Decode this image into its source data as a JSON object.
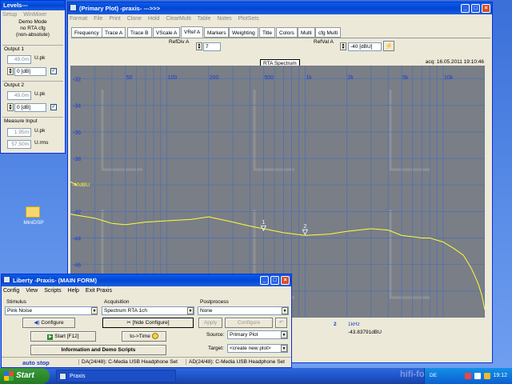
{
  "levels_window": {
    "title": "Levels---",
    "menu": [
      "Setup",
      "WinMixer"
    ],
    "mode_line1": "Demo Mode",
    "mode_line2": "no RTA cfg",
    "mode_line3": "(non-absolute)",
    "output1": {
      "label": "Output 1",
      "value": "49.0m",
      "unit": "U.pk",
      "db": "0 [dB]"
    },
    "output2": {
      "label": "Output 2",
      "value": "49.0m",
      "unit": "U.pk",
      "db": "0 [dB]"
    },
    "measure_input": {
      "label": "Measure Input",
      "value1": "1.95m",
      "unit1": "U.pk",
      "value2": "57.50m",
      "unit2": "U.rms"
    }
  },
  "desktop_icon": {
    "label": "MiniDSP"
  },
  "plot_window": {
    "title": "(Primary Plot) -praxis-   --->>>",
    "menu": [
      "Format",
      "File",
      "Print",
      "Clone",
      "Hold",
      "ClearMulti",
      "Table",
      "Notes",
      "PlotSets"
    ],
    "tabs": [
      "Frequency",
      "Trace A",
      "Trace B",
      "VScale A",
      "VRef A",
      "Markers",
      "Weighting",
      "Title",
      "Colors",
      "Multi",
      "cfg Multi"
    ],
    "active_tab": "VRef A",
    "refdiv_label": "RefDiv A",
    "refdiv_value": "7",
    "refval_label": "RefVal A",
    "refval_value": "-40 [dBU]",
    "plot_title": "RTA Spectrum",
    "acq": "acq: 16.05.2011 19:10:46",
    "ref_marker": "-40dBU",
    "marker_labels": [
      "1",
      "2"
    ],
    "readout_marker": "2",
    "readout_freq": "1kHz",
    "readout_value": "-43.83791dBU"
  },
  "chart_data": {
    "type": "line",
    "title": "RTA Spectrum",
    "x_scale": "log",
    "xlim": [
      20,
      20000
    ],
    "ylim": [
      -50,
      -31
    ],
    "x_ticks": [
      {
        "v": 50,
        "l": "50"
      },
      {
        "v": 100,
        "l": "100"
      },
      {
        "v": 200,
        "l": "200"
      },
      {
        "v": 500,
        "l": "500"
      },
      {
        "v": 1000,
        "l": "1k"
      },
      {
        "v": 2000,
        "l": "2k"
      },
      {
        "v": 5000,
        "l": "5k"
      },
      {
        "v": 10000,
        "l": "10k"
      }
    ],
    "y_ticks": [
      {
        "v": -32,
        "l": "-32"
      },
      {
        "v": -34,
        "l": "-34"
      },
      {
        "v": -36,
        "l": "-36"
      },
      {
        "v": -38,
        "l": "-38"
      },
      {
        "v": -40,
        "l": ""
      },
      {
        "v": -42,
        "l": "-42"
      },
      {
        "v": -44,
        "l": "-44"
      },
      {
        "v": -46,
        "l": "-46"
      },
      {
        "v": -48,
        "l": "-48"
      }
    ],
    "series": [
      {
        "color": "#ffff33",
        "x": [
          20,
          30,
          40,
          50,
          70,
          100,
          150,
          200,
          300,
          400,
          500,
          700,
          1000,
          1500,
          2000,
          3000,
          4000,
          5000,
          6000,
          7000,
          8000,
          10000,
          12000,
          14000,
          15000,
          16000,
          17000,
          18000,
          19000,
          20000
        ],
        "y": [
          -42.2,
          -42.5,
          -42.9,
          -43.0,
          -42.8,
          -42.7,
          -42.6,
          -42.4,
          -42.8,
          -43.1,
          -43.3,
          -43.6,
          -43.8,
          -43.7,
          -43.5,
          -43.3,
          -43.4,
          -43.8,
          -43.9,
          -44.0,
          -44.0,
          -44.3,
          -44.8,
          -45.3,
          -45.8,
          -46.3,
          -46.9,
          -47.5,
          -48.3,
          -49.4
        ]
      }
    ],
    "markers": [
      {
        "label": "1",
        "x": 500,
        "y": -43.5
      },
      {
        "label": "2",
        "x": 1000,
        "y": -43.8
      }
    ]
  },
  "main_form": {
    "title": "Liberty -Praxis- (MAIN FORM)",
    "menu": [
      "Config",
      "View",
      "Scripts",
      "Help",
      "Exit Praxis"
    ],
    "stimulus_label": "Stimulus",
    "stimulus_value": "Pink Noise",
    "configure": "Configure",
    "acquisition_label": "Acquisition",
    "acquisition_value": "Spectrum RTA 1ch",
    "hide_configure": "[hide Configure]",
    "postprocess_label": "Postprocess",
    "postprocess_value": "None",
    "apply": "Apply",
    "configure2": "Configure",
    "start": "Start [F12]",
    "to_time": "to->Time",
    "info": "Information and Demo Scripts",
    "source_label": "Source:",
    "source_value": "Primary Plot",
    "target_label": "Target:",
    "target_value": "<create new plot>",
    "status_auto": "auto stop",
    "status_da": "DA(24/48): C-Media USB Headphone Set",
    "status_ad": "AD(24/48): C-Media USB Headphone Set"
  },
  "taskbar": {
    "start": "Start",
    "task": "Praxis",
    "lang": "DE",
    "clock": "19:12",
    "watermark": "hifi-fo"
  }
}
